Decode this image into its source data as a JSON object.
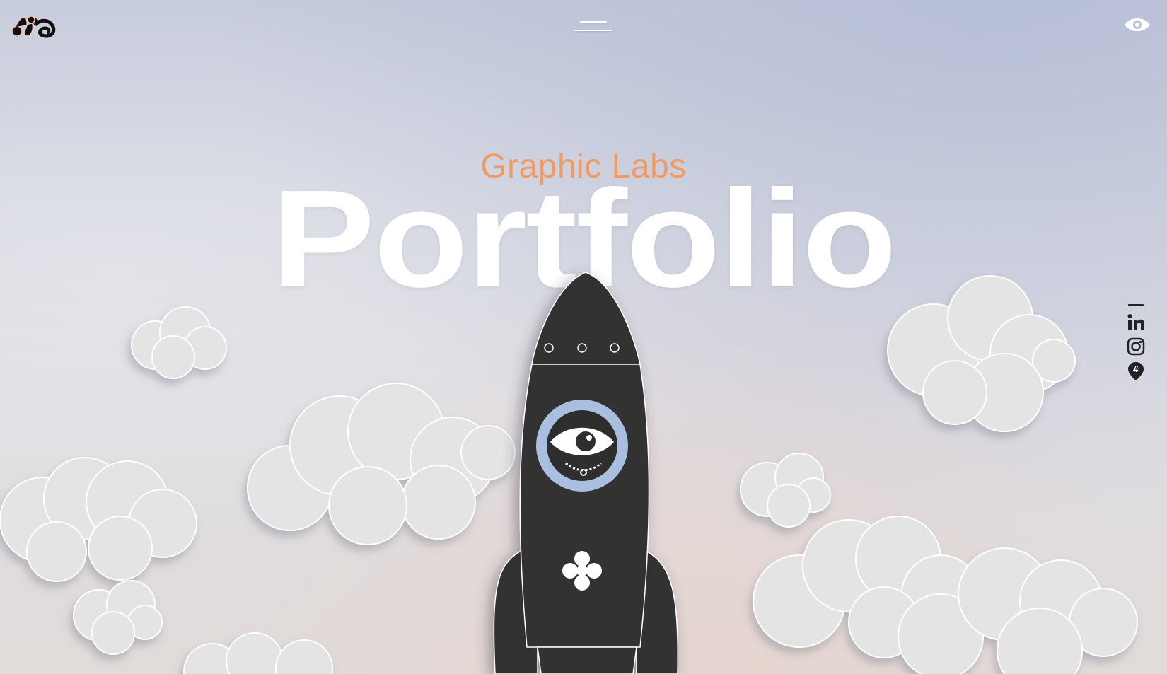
{
  "header": {
    "logo": "hb-logo",
    "menu_icon": "hamburger-menu-icon",
    "eye_icon": "eye-icon"
  },
  "hero": {
    "subtitle": "Graphic Labs",
    "title": "Portfolio"
  },
  "social": {
    "items": [
      {
        "name": "linkedin",
        "icon": "linkedin-icon",
        "label": "in"
      },
      {
        "name": "instagram",
        "icon": "instagram-icon"
      },
      {
        "name": "hashtag-location",
        "icon": "hashtag-pin-icon",
        "label": "#"
      }
    ]
  },
  "colors": {
    "accent": "#f29a63",
    "rocket": "#333333",
    "porthole_ring": "#a9bfe0",
    "cloud": "#e4e4e4",
    "title": "#ffffff"
  }
}
